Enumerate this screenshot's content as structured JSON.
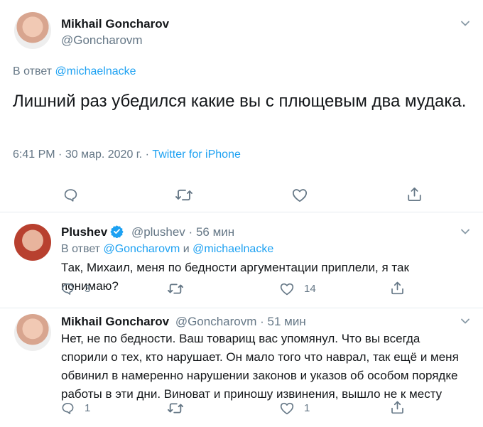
{
  "main_tweet": {
    "author_name": "Mikhail Goncharov",
    "author_handle": "@Goncharovm",
    "reply_prefix": "В ответ",
    "reply_to": "@michaelnacke",
    "text": "Лишний раз убедился какие вы с плющевым два мудака.",
    "time": "6:41 PM",
    "date": "30 мар. 2020 г.",
    "separator": "·",
    "source": "Twitter for iPhone"
  },
  "replies": [
    {
      "author_name": "Plushev",
      "verified": true,
      "author_handle": "@plushev",
      "separator": "·",
      "age": "56 мин",
      "reply_prefix": "В ответ",
      "reply_to_1": "@Goncharovm",
      "reply_conj": "и",
      "reply_to_2": "@michaelnacke",
      "text": "Так, Михаил, меня по бедности аргументации приплели, я так понимаю?",
      "replies_count": "3",
      "likes_count": "14"
    },
    {
      "author_name": "Mikhail Goncharov",
      "author_handle": "@Goncharovm",
      "separator": "·",
      "age": "51 мин",
      "text": "Нет, не по бедности. Ваш товарищ вас упомянул. Что вы всегда спорили о тех, кто нарушает. Он мало того что наврал, так ещё и меня обвинил в намеренно нарушении законов и указов об особом порядке работы в эти дни. Виноват и приношу извинения, вышло не к месту",
      "replies_count": "1",
      "likes_count": "1"
    }
  ],
  "colors": {
    "link": "#1da1f2",
    "muted": "#657786",
    "text": "#14171a",
    "divider": "#e6ecf0",
    "verified": "#1da1f2"
  },
  "icons": [
    "avatar",
    "chevron-down-icon",
    "reply-icon",
    "retweet-icon",
    "like-icon",
    "share-icon",
    "verified-badge-icon"
  ]
}
